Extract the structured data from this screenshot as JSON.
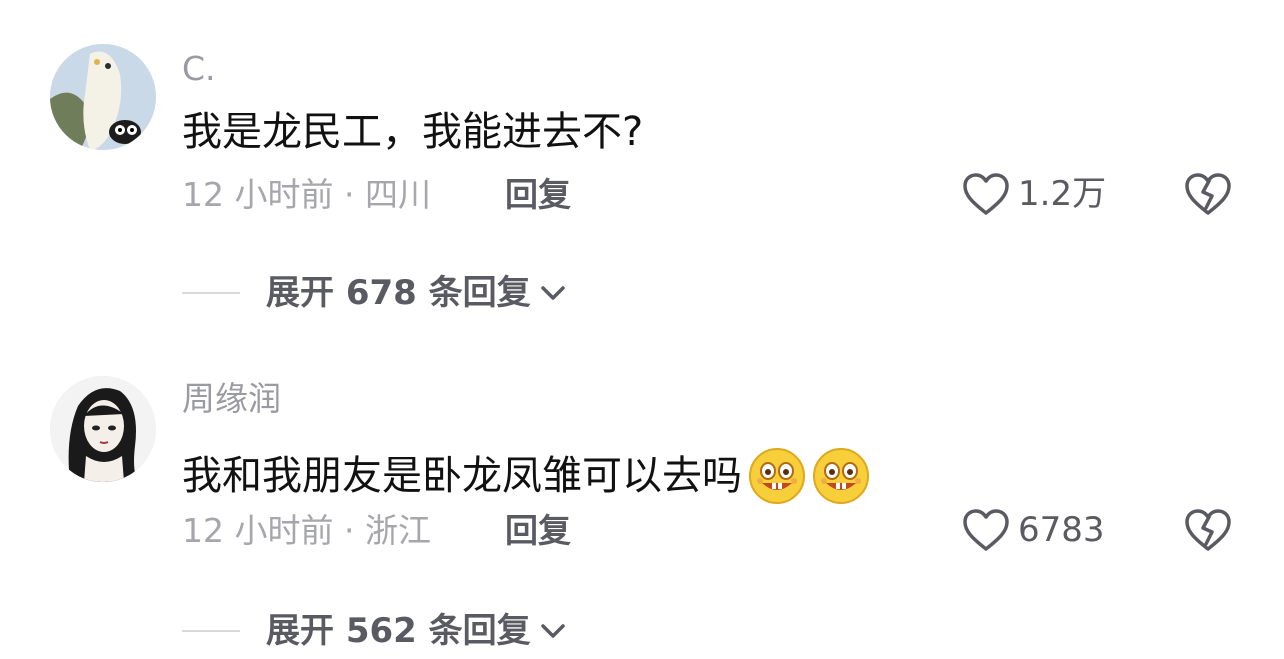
{
  "comments": [
    {
      "username": "C.",
      "text": "我是龙民工，我能进去不?",
      "meta": "12 小时前 · 四川",
      "reply_label": "回复",
      "likes": "1.2万",
      "expand_label": "展开 678 条回复"
    },
    {
      "username": "周缘润",
      "text": "我和我朋友是卧龙凤雏可以去吗",
      "meta": "12 小时前 · 浙江",
      "reply_label": "回复",
      "likes": "6783",
      "expand_label": "展开 562 条回复"
    }
  ],
  "icons": {
    "like": "heart-outline-icon",
    "dislike": "broken-heart-icon",
    "expand": "chevron-down-icon",
    "emoji": "grin-face-emoji"
  },
  "colors": {
    "name": "#9a9aa3",
    "text": "#111111",
    "meta": "#a6a6ad",
    "action": "#5a5a63"
  }
}
